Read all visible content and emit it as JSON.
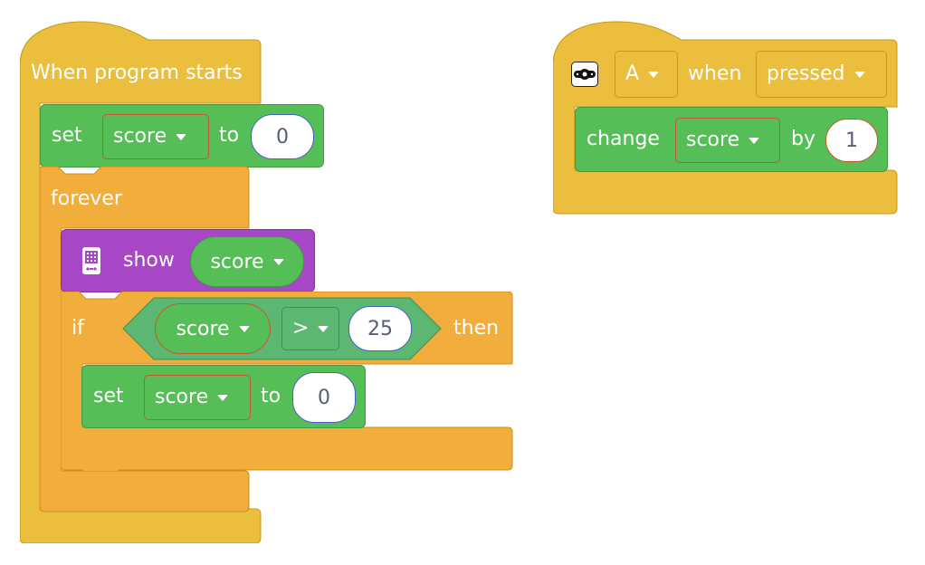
{
  "hat_left": {
    "label": "When program starts",
    "set1": {
      "label": "set",
      "variable": "score",
      "to_label": "to",
      "value": "0"
    },
    "forever": {
      "label": "forever",
      "show": {
        "label": "show",
        "variable": "score"
      },
      "if": {
        "label": "if",
        "then_label": "then",
        "condition": {
          "left": "score",
          "operator": ">",
          "right": "25"
        },
        "set2": {
          "label": "set",
          "variable": "score",
          "to_label": "to",
          "value": "0"
        }
      }
    }
  },
  "hat_right": {
    "icon": "gamepad-button-icon",
    "button": "A",
    "when_label": "when",
    "state": "pressed",
    "change": {
      "label": "change",
      "variable": "score",
      "by_label": "by",
      "value": "1"
    }
  },
  "colors": {
    "events_yellow": "#ECBE3E",
    "loops_orange": "#F2AE3D",
    "variables_green": "#56BE57",
    "display_purple": "#A747C6",
    "logic_green": "#5CB773"
  }
}
